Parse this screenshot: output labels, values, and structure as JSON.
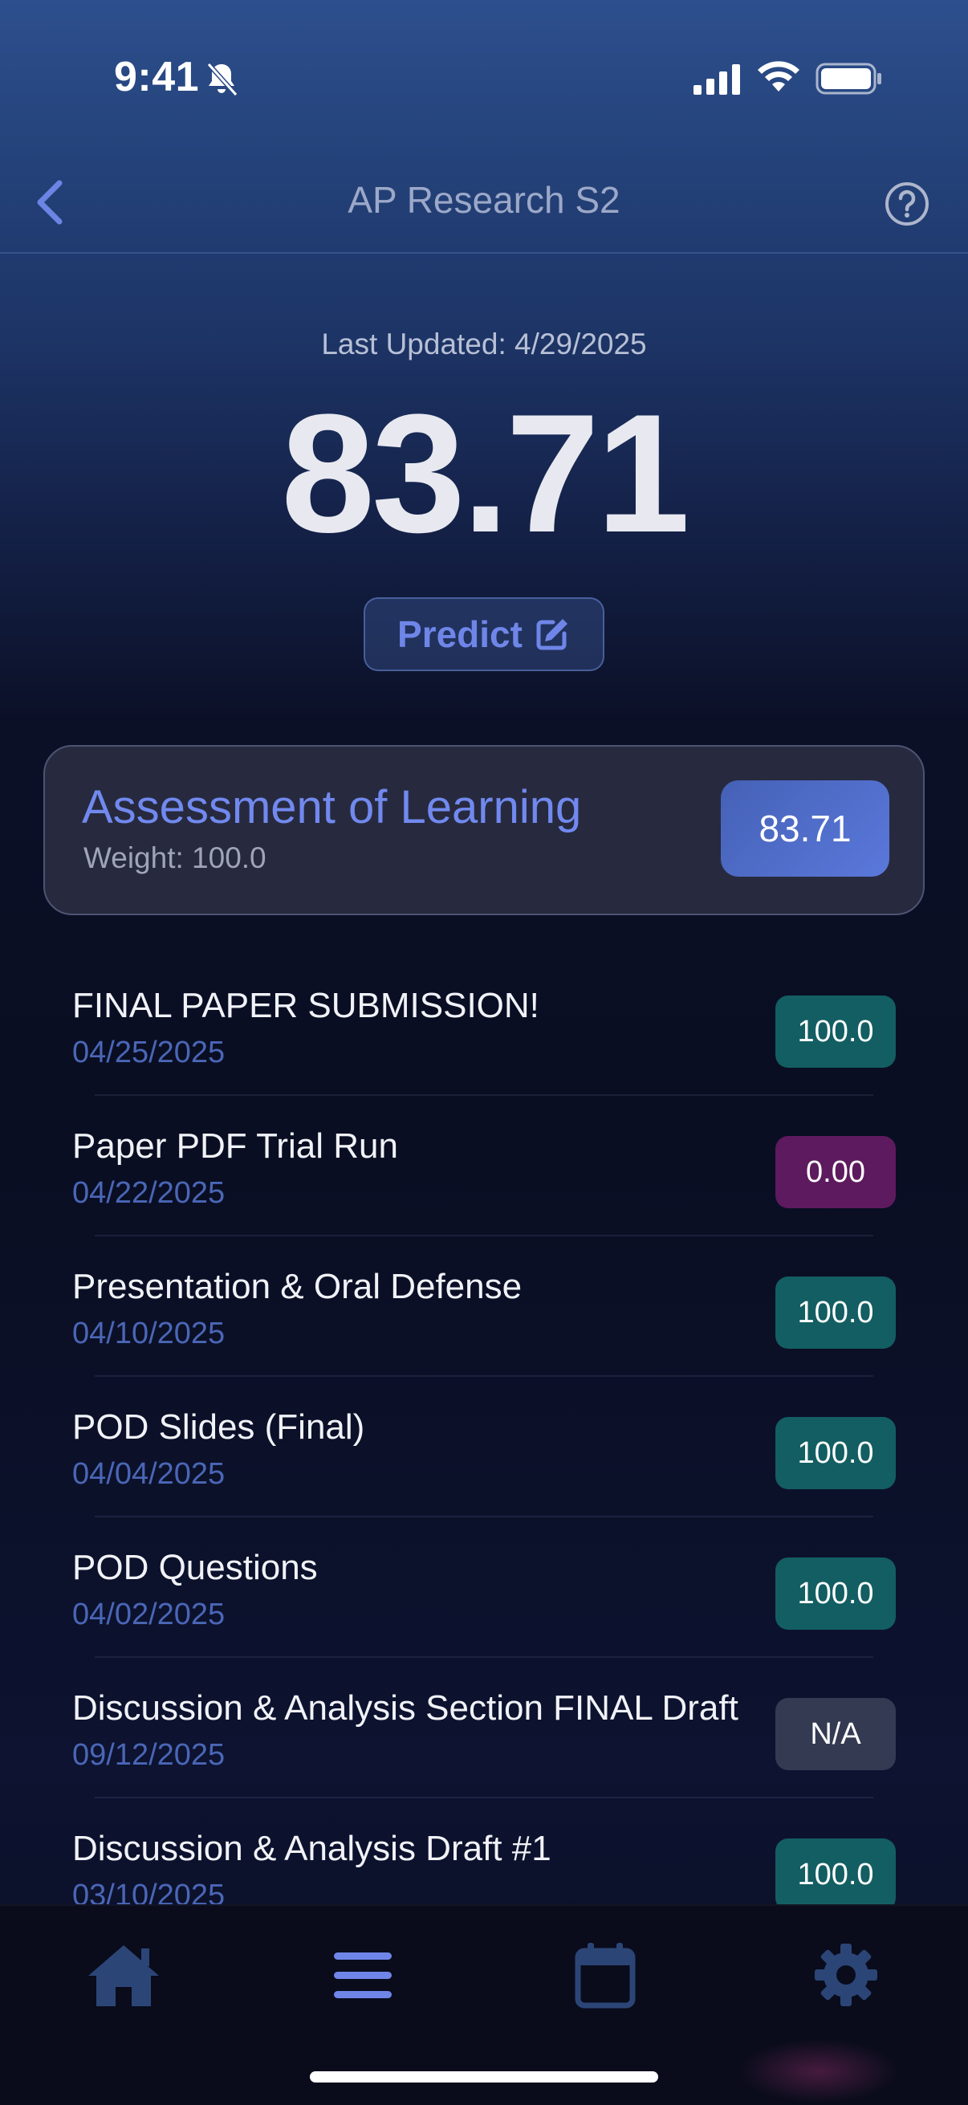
{
  "status_bar": {
    "time": "9:41"
  },
  "nav": {
    "title": "AP Research S2"
  },
  "header": {
    "last_updated": "Last Updated: 4/29/2025",
    "grade": "83.71",
    "predict_label": "Predict"
  },
  "category": {
    "name": "Assessment of Learning",
    "weight": "Weight: 100.0",
    "score": "83.71"
  },
  "assignments": [
    {
      "name": "FINAL PAPER SUBMISSION!",
      "date": "04/25/2025",
      "score": "100.0",
      "status": "full"
    },
    {
      "name": "Paper PDF Trial Run",
      "date": "04/22/2025",
      "score": "0.00",
      "status": "zero"
    },
    {
      "name": "Presentation & Oral Defense",
      "date": "04/10/2025",
      "score": "100.0",
      "status": "full"
    },
    {
      "name": "POD Slides (Final)",
      "date": "04/04/2025",
      "score": "100.0",
      "status": "full"
    },
    {
      "name": "POD Questions",
      "date": "04/02/2025",
      "score": "100.0",
      "status": "full"
    },
    {
      "name": "Discussion & Analysis Section FINAL Draft",
      "date": "09/12/2025",
      "score": "N/A",
      "status": "na"
    },
    {
      "name": "Discussion & Analysis Draft #1",
      "date": "03/10/2025",
      "score": "100.0",
      "status": "full"
    }
  ],
  "colors": {
    "accent": "#6f86e8",
    "badge_full": "#135e62",
    "badge_zero": "#5e1a5e",
    "badge_na": "#343a52",
    "tab_active": "#6f86e8",
    "tab_inactive": "#2c4577"
  },
  "tabs": [
    {
      "icon": "home-icon",
      "active": false
    },
    {
      "icon": "list-icon",
      "active": true
    },
    {
      "icon": "calendar-icon",
      "active": false
    },
    {
      "icon": "gear-icon",
      "active": false
    }
  ]
}
